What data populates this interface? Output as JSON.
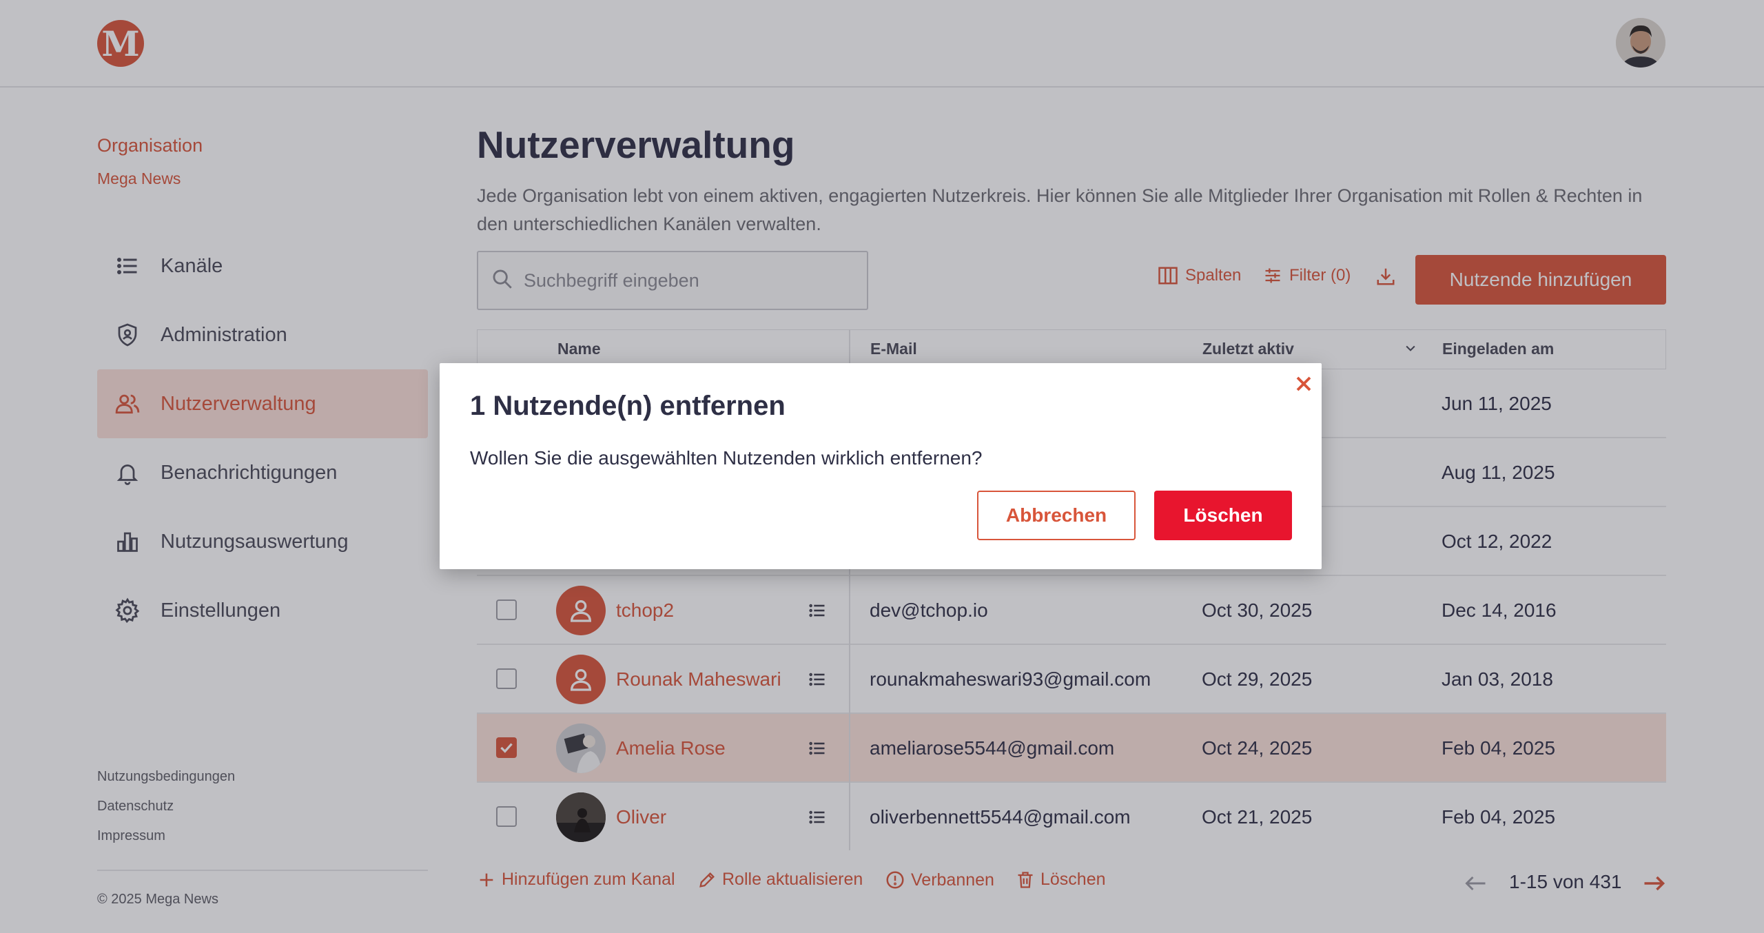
{
  "app": {
    "logo_letter": "M"
  },
  "organization": {
    "label": "Organisation",
    "name": "Mega News"
  },
  "sidebar": {
    "items": [
      {
        "label": "Kanäle",
        "icon": "list-icon",
        "active": false
      },
      {
        "label": "Administration",
        "icon": "shield-person-icon",
        "active": false
      },
      {
        "label": "Nutzerverwaltung",
        "icon": "users-icon",
        "active": true
      },
      {
        "label": "Benachrichtigungen",
        "icon": "bell-icon",
        "active": false
      },
      {
        "label": "Nutzungsauswertung",
        "icon": "bar-chart-icon",
        "active": false
      },
      {
        "label": "Einstellungen",
        "icon": "gear-icon",
        "active": false
      }
    ],
    "footer_links": [
      "Nutzungsbedingungen",
      "Datenschutz",
      "Impressum"
    ],
    "copyright": "© 2025 Mega News"
  },
  "page": {
    "title": "Nutzerverwaltung",
    "description": "Jede Organisation lebt von einem aktiven, engagierten Nutzerkreis. Hier können Sie alle Mitglieder Ihrer Organisation mit Rollen & Rechten in den unterschiedlichen Kanälen verwalten."
  },
  "toolbar": {
    "search_placeholder": "Suchbegriff eingeben",
    "columns_label": "Spalten",
    "filter_label": "Filter (0)",
    "add_button": "Nutzende hinzufügen"
  },
  "table": {
    "headers": {
      "name": "Name",
      "email": "E-Mail",
      "last_active": "Zuletzt aktiv",
      "invited": "Eingeladen am"
    },
    "rows": [
      {
        "name": "",
        "email": "",
        "last_active": "",
        "invited": "Jun 11, 2025",
        "checked": false,
        "avatar": "default"
      },
      {
        "name": "",
        "email": "",
        "last_active": "",
        "invited": "Aug 11, 2025",
        "checked": false,
        "avatar": "default"
      },
      {
        "name": "",
        "email": "",
        "last_active": "",
        "invited": "Oct 12, 2022",
        "checked": false,
        "avatar": "default"
      },
      {
        "name": "tchop2",
        "email": "dev@tchop.io",
        "last_active": "Oct 30, 2025",
        "invited": "Dec 14, 2016",
        "checked": false,
        "avatar": "default"
      },
      {
        "name": "Rounak Maheswari",
        "email": "rounakmaheswari93@gmail.com",
        "last_active": "Oct 29, 2025",
        "invited": "Jan 03, 2018",
        "checked": false,
        "avatar": "default"
      },
      {
        "name": "Amelia Rose",
        "email": "ameliarose5544@gmail.com",
        "last_active": "Oct 24, 2025",
        "invited": "Feb 04, 2025",
        "checked": true,
        "avatar": "photo"
      },
      {
        "name": "Oliver",
        "email": "oliverbennett5544@gmail.com",
        "last_active": "Oct 21, 2025",
        "invited": "Feb 04, 2025",
        "checked": false,
        "avatar": "photo"
      }
    ]
  },
  "bulk_actions": {
    "add_to_channel": "Hinzufügen zum Kanal",
    "update_role": "Rolle aktualisieren",
    "ban": "Verbannen",
    "delete": "Löschen"
  },
  "pagination": {
    "text": "1-15 von 431"
  },
  "modal": {
    "title": "1 Nutzende(n) entfernen",
    "message": "Wollen Sie die ausgewählten Nutzenden wirklich entfernen?",
    "cancel_label": "Abbrechen",
    "confirm_label": "Löschen"
  },
  "colors": {
    "accent": "#d8553a",
    "danger": "#e8152e",
    "selected_row": "#fbe2da"
  }
}
